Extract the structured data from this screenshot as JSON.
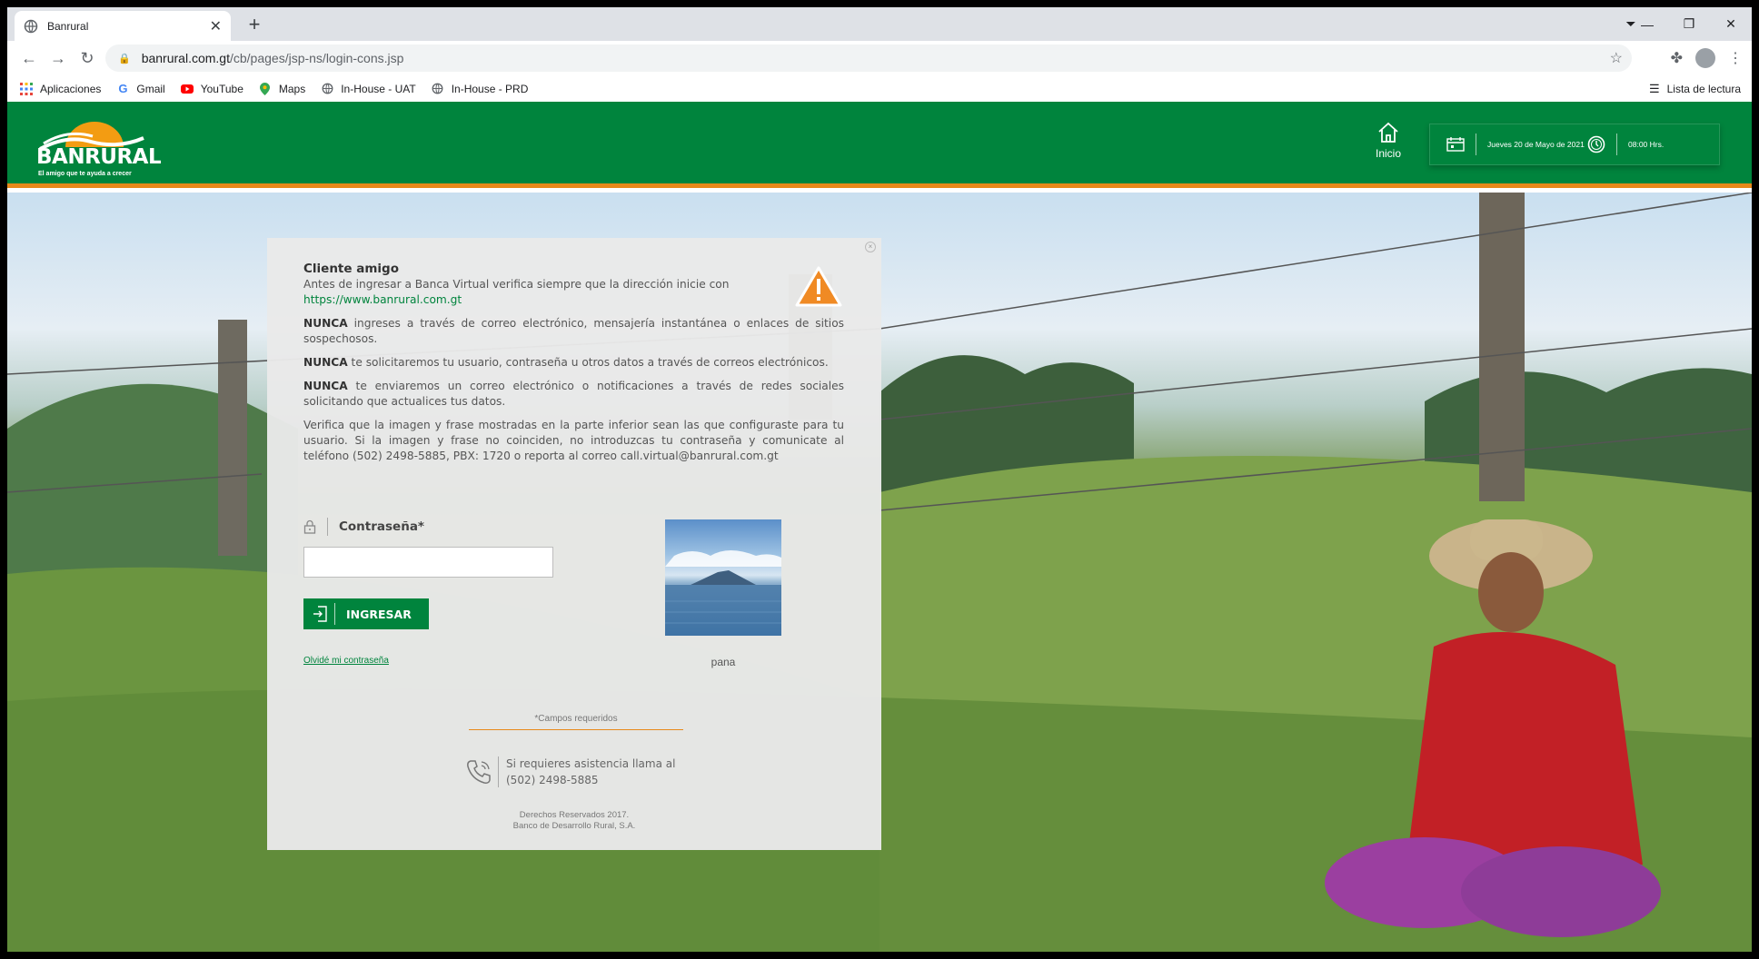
{
  "browser": {
    "tab_title": "Banrural",
    "url_host": "banrural.com.gt",
    "url_path": "/cb/pages/jsp-ns/login-cons.jsp",
    "bookmarks": [
      {
        "label": "Aplicaciones",
        "icon": "apps-grid-icon"
      },
      {
        "label": "Gmail",
        "icon": "google-icon"
      },
      {
        "label": "YouTube",
        "icon": "youtube-icon"
      },
      {
        "label": "Maps",
        "icon": "maps-pin-icon"
      },
      {
        "label": "In-House - UAT",
        "icon": "globe-icon"
      },
      {
        "label": "In-House - PRD",
        "icon": "globe-icon"
      }
    ],
    "reading_list": "Lista de lectura"
  },
  "header": {
    "logo_text": "BANRURAL",
    "logo_tagline": "El amigo que te ayuda a crecer",
    "nav_home": "Inicio",
    "date": "Jueves 20 de Mayo de 2021",
    "time": "08:00 Hrs.",
    "colors": {
      "brand_green": "#00843d",
      "accent_orange": "#e8891a"
    }
  },
  "notice": {
    "title": "Cliente amigo",
    "intro": "Antes de ingresar a Banca Virtual verifica siempre que la dirección inicie con",
    "link": "https://www.banrural.com.gt",
    "p1_bold": "NUNCA",
    "p1": " ingreses a través de correo electrónico, mensajería instantánea o enlaces de sitios sospechosos.",
    "p2_bold": "NUNCA",
    "p2": " te solicitaremos tu usuario, contraseña u otros datos a través de correos electrónicos.",
    "p3_bold": "NUNCA",
    "p3": " te enviaremos un correo electrónico o notificaciones a través de redes sociales solicitando que actualices tus datos.",
    "p4": "Verifica que la imagen y frase mostradas en la parte inferior sean las que configuraste para tu usuario. Si la imagen y frase no coinciden, no introduzcas tu contraseña y comunicate al teléfono (502) 2498-5885, PBX: 1720 o reporta al correo call.virtual@banrural.com.gt"
  },
  "login": {
    "password_label": "Contraseña*",
    "password_value": "",
    "submit_label": "INGRESAR",
    "forgot_link": "Olvidé mi contraseña",
    "security_phrase": "pana",
    "required_note": "*Campos requeridos",
    "assist_line1": "Si requieres asistencia llama al",
    "assist_line2": "(502) 2498-5885",
    "footer_line1": "Derechos Reservados 2017.",
    "footer_line2": "Banco de Desarrollo Rural, S.A."
  }
}
